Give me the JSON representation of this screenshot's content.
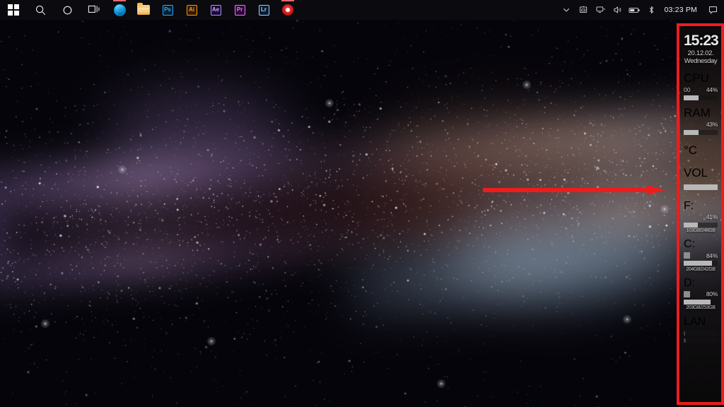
{
  "taskbar": {
    "left_items": [
      {
        "name": "start-button",
        "icon": "windows-logo-icon",
        "label": "Start"
      },
      {
        "name": "search-button",
        "icon": "search-icon",
        "label": "Search"
      },
      {
        "name": "cortana-button",
        "icon": "cortana-circle-icon",
        "label": "Cortana"
      },
      {
        "name": "task-view-button",
        "icon": "task-view-icon",
        "label": "Task View"
      },
      {
        "name": "edge-button",
        "icon": "edge-browser-icon",
        "label": "Microsoft Edge"
      },
      {
        "name": "file-explorer-button",
        "icon": "folder-icon",
        "label": "File Explorer"
      },
      {
        "name": "photoshop-button",
        "icon": "photoshop-icon",
        "label": "Ps"
      },
      {
        "name": "illustrator-button",
        "icon": "illustrator-icon",
        "label": "Ai"
      },
      {
        "name": "after-effects-button",
        "icon": "after-effects-icon",
        "label": "Ae"
      },
      {
        "name": "premiere-button",
        "icon": "premiere-pro-icon",
        "label": "Pr"
      },
      {
        "name": "lightroom-button",
        "icon": "lightroom-icon",
        "label": "Lr"
      },
      {
        "name": "recorder-button",
        "icon": "record-circle-icon",
        "label": "Recorder"
      }
    ],
    "tray": {
      "chevron_label": "Show hidden icons",
      "items": [
        {
          "name": "onedrive-icon",
          "label": "OneDrive"
        },
        {
          "name": "network-icon",
          "label": "Network"
        },
        {
          "name": "volume-icon",
          "label": "Volume"
        },
        {
          "name": "battery-icon",
          "label": "Battery"
        },
        {
          "name": "bluetooth-icon",
          "label": "Bluetooth"
        }
      ],
      "clock": "03:23 PM",
      "action_center_label": "Notifications"
    }
  },
  "widget_panel": {
    "clock": {
      "time": "15:23",
      "date": "20.12.02.",
      "weekday": "Wednesday"
    },
    "cpu": {
      "label": "CPU",
      "core_value": "00",
      "separator": ".",
      "percent_text": "44%",
      "percent": 44,
      "bar_fill": 44
    },
    "ram": {
      "label": "RAM",
      "percent_text": "43%",
      "percent": 43,
      "bar_fill": 43
    },
    "temperature": {
      "label": "°C",
      "value_text": ""
    },
    "volume": {
      "label": "VOL",
      "bar_fill": 100
    },
    "drives": [
      {
        "label": "F:",
        "percent_text": "41%",
        "percent": 41,
        "bar_fill": 41,
        "capacity_text": "103GB/248GB"
      },
      {
        "label": "C:",
        "percent_text": "84%",
        "percent": 84,
        "bar_fill": 84,
        "capacity_text": "204GB/242GB"
      },
      {
        "label": "D:",
        "percent_text": "80%",
        "percent": 80,
        "bar_fill": 80,
        "capacity_text": "203GB/253GB"
      }
    ],
    "lan": {
      "label": "LAN",
      "upload_fill": 4,
      "download_fill": 6
    }
  },
  "annotations": {
    "highlight_color": "#f01c1c",
    "box_label": "widget-panel-highlight",
    "arrow_label": "pointer-arrow-to-widget-panel"
  },
  "wallpaper": {
    "description": "Milky Way galaxy night sky",
    "base_color": "#05040a"
  }
}
